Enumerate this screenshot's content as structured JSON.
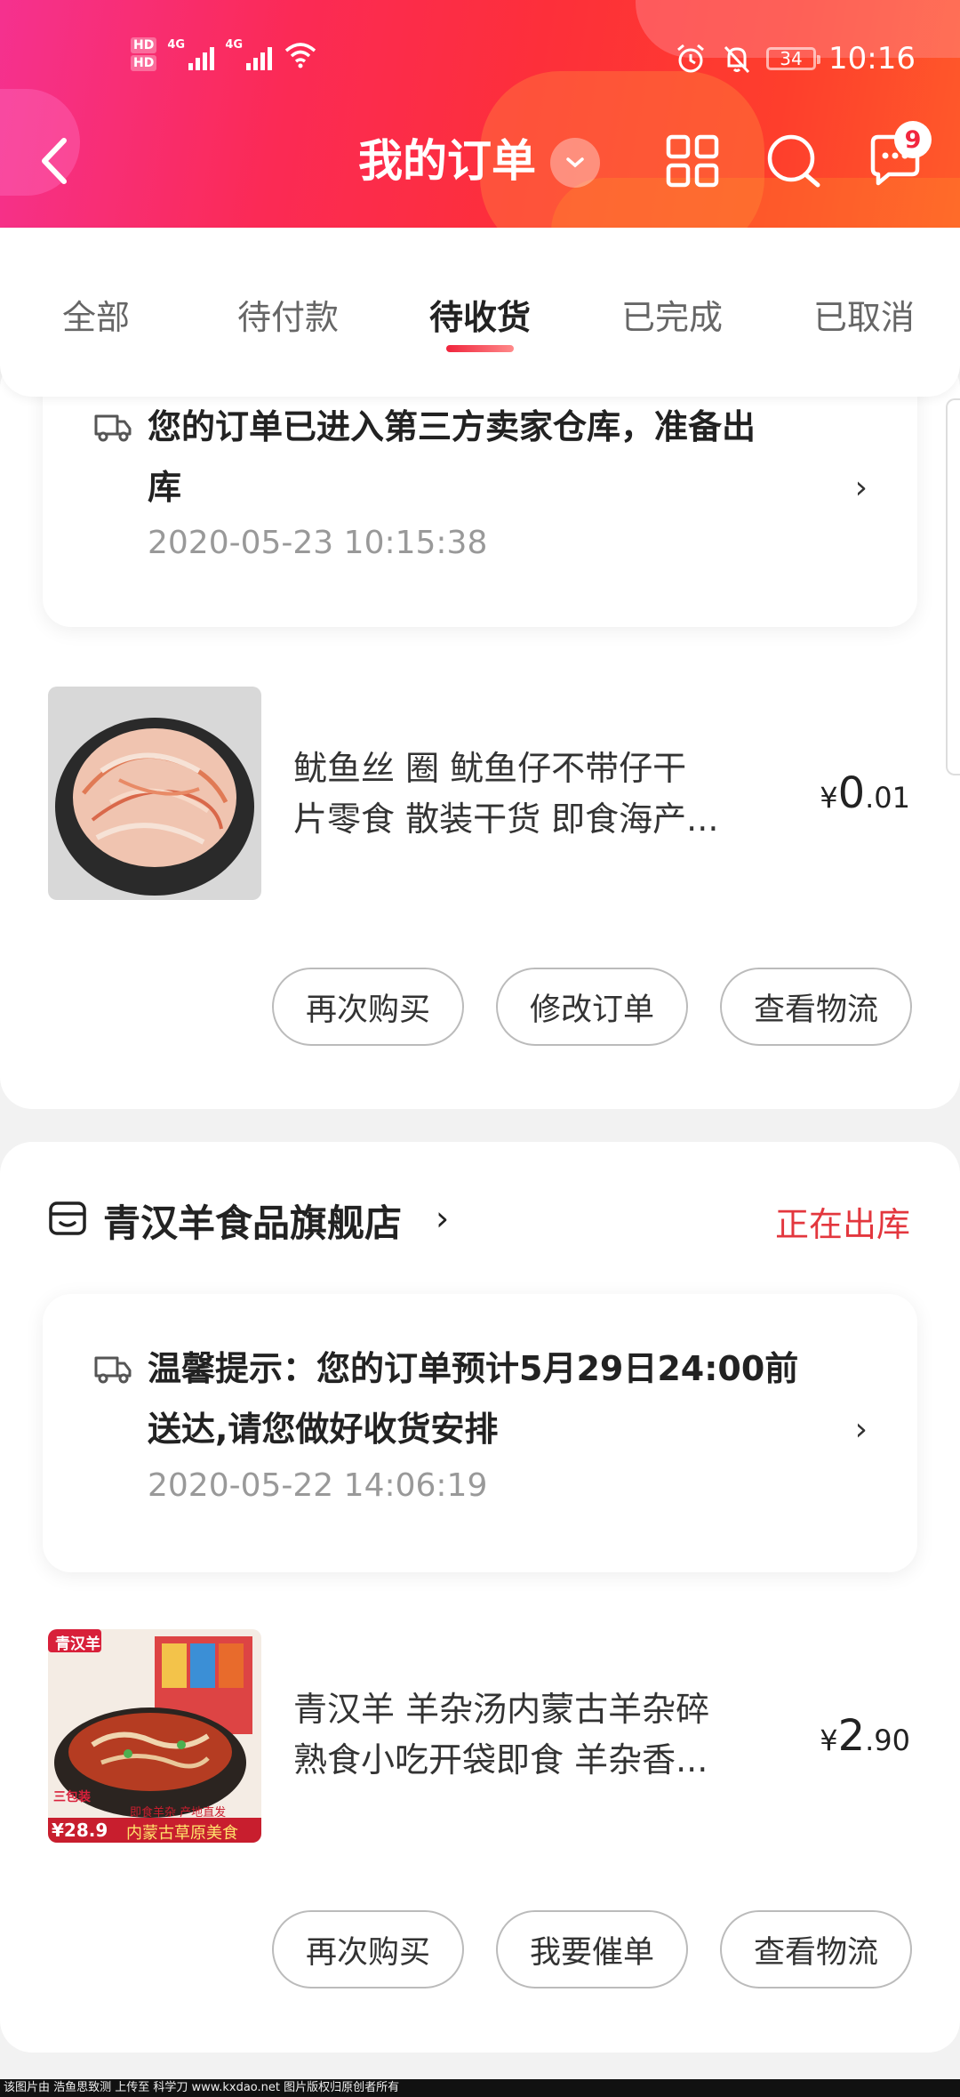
{
  "status_bar": {
    "hd1": "HD",
    "hd2": "HD",
    "net1": "4G",
    "net2": "4G",
    "battery": "34",
    "time": "10:16"
  },
  "header": {
    "title": "我的订单",
    "badge_count": "9",
    "icons": [
      "back-arrow-icon",
      "chevron-down-icon",
      "grid-icon",
      "search-icon",
      "message-icon"
    ]
  },
  "tabs": [
    {
      "label": "全部",
      "active": false
    },
    {
      "label": "待付款",
      "active": false
    },
    {
      "label": "待收货",
      "active": true
    },
    {
      "label": "已完成",
      "active": false
    },
    {
      "label": "已取消",
      "active": false
    }
  ],
  "orders": [
    {
      "logistics": {
        "line1": "您的订单已进入第三方卖家仓库，准备出",
        "line2": "库",
        "time": "2020-05-23 10:15:38"
      },
      "product": {
        "name_line1": "鱿鱼丝  圈 鱿鱼仔不带仔干",
        "name_line2": "片零食 散装干货 即食海产...",
        "price_currency": "¥",
        "price_int": "0",
        "price_dec": ".01"
      },
      "buttons": [
        "再次购买",
        "修改订单",
        "查看物流"
      ]
    },
    {
      "store_name": "青汉羊食品旗舰店",
      "store_chevron": "›",
      "status": "正在出库",
      "logistics": {
        "line1": "温馨提示：您的订单预计5月29日24:00前",
        "line2": "送达,请您做好收货安排",
        "time": "2020-05-22 14:06:19"
      },
      "product": {
        "image_texts": {
          "brand": "青汉羊",
          "pack": "三包装",
          "price": "¥28.9",
          "tagline1": "即食羊杂 产地直发",
          "tagline2": "内蒙古草原美食"
        },
        "name_line1": "青汉羊 羊杂汤内蒙古羊杂碎",
        "name_line2": "熟食小吃开袋即食 羊杂香...",
        "price_currency": "¥",
        "price_int": "2",
        "price_dec": ".90"
      },
      "buttons": [
        "再次购买",
        "我要催单",
        "查看物流"
      ]
    }
  ],
  "footer": "该图片由 浩鱼思致测 上传至 科学刀 www.kxdao.net 图片版权归原创者所有",
  "colors": {
    "accent_red": "#e3373e",
    "header_start": "#f5318f",
    "header_end": "#ff5a2a"
  }
}
